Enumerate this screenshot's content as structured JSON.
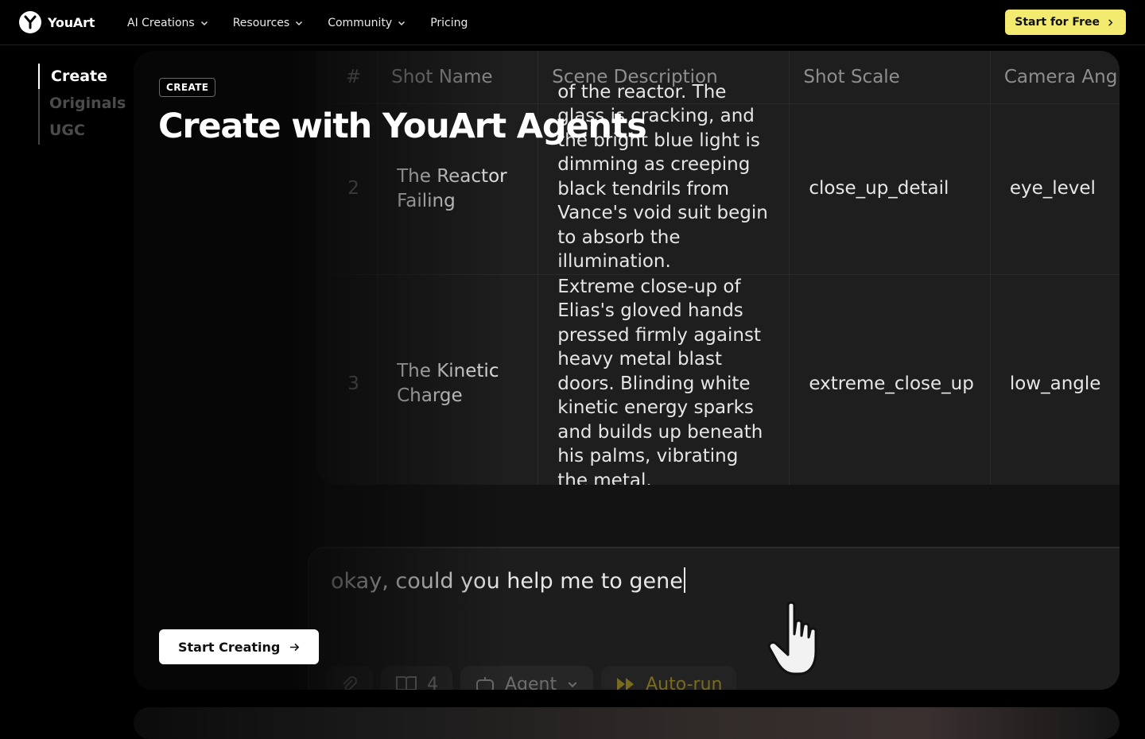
{
  "brand": {
    "name": "YouArt",
    "accent": "#f3ea70"
  },
  "nav": {
    "items": [
      {
        "label": "AI Creations",
        "has_dropdown": true
      },
      {
        "label": "Resources",
        "has_dropdown": true
      },
      {
        "label": "Community",
        "has_dropdown": true
      },
      {
        "label": "Pricing",
        "has_dropdown": false
      }
    ],
    "cta_label": "Start for Free"
  },
  "sidemenu": {
    "items": [
      {
        "label": "Create",
        "active": true
      },
      {
        "label": "Originals",
        "active": false
      },
      {
        "label": "UGC",
        "active": false
      }
    ]
  },
  "hero": {
    "badge": "CREATE",
    "title": "Create with YouArt Agents",
    "cta_label": "Start Creating"
  },
  "demo": {
    "table": {
      "headers": [
        "#",
        "Shot Name",
        "Scene Description",
        "Shot Scale",
        "Camera Ang"
      ],
      "rows": [
        {
          "num": "2",
          "shot_name": "The Reactor Failing",
          "description": "of the reactor. The glass is cracking, and the bright blue light is dimming as creeping black tendrils from Vance's void suit begin to absorb the illumination.",
          "scale": "close_up_detail",
          "angle": "eye_level"
        },
        {
          "num": "3",
          "shot_name": "The Kinetic Charge",
          "description": "Extreme close-up of Elias's gloved hands pressed firmly against heavy metal blast doors. Blinding white kinetic energy sparks and builds up beneath his palms, vibrating the metal.",
          "scale": "extreme_close_up",
          "angle": "low_angle"
        }
      ]
    },
    "chat": {
      "input_text": "okay, could you help me to gene",
      "tools": [
        {
          "icon": "paperclip-icon",
          "label": ""
        },
        {
          "icon": "book-icon",
          "label": "4"
        },
        {
          "icon": "robot-icon",
          "label": "Agent"
        },
        {
          "icon": "fast-forward-icon",
          "label": "Auto-run"
        }
      ]
    }
  }
}
